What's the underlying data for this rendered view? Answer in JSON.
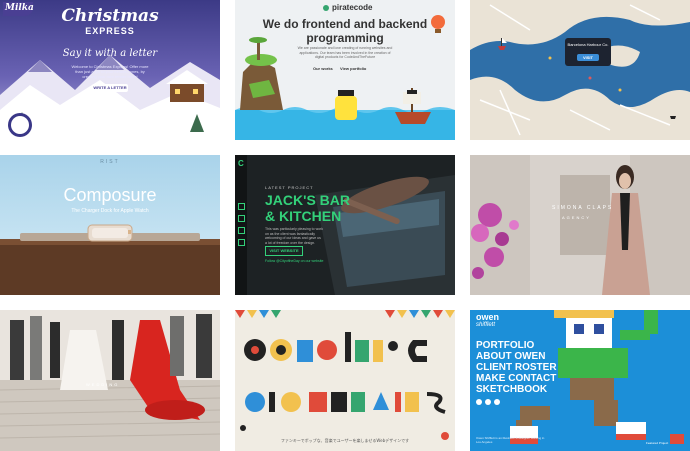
{
  "tiles": {
    "milka": {
      "logo": "Milka",
      "title_line1": "Christmas",
      "title_line2": "EXPRESS",
      "tagline": "Say it with a letter",
      "body": "Welcome to Christmas Express! Offer more than just a gift to your beloved ones, by creating your own tender letter!",
      "button": "WRITE A LETTER"
    },
    "piratecode": {
      "logo": "piratecode",
      "headline_line1": "We do frontend and backend",
      "headline_line2": "programming",
      "body": "We are passionate and love creating of running websites and applications. Our team has been involved in the creation of digital products for CodeAndTheFuture",
      "link1": "Our works",
      "link2": "View portfolio"
    },
    "map": {
      "popup_title": "Barcelona Harbour Co.",
      "popup_button": "VISIT"
    },
    "composure": {
      "brand": "RIST",
      "title": "Composure",
      "subtitle": "The Charger Dock for Apple Watch"
    },
    "jacks": {
      "logo": "C",
      "label": "LATEST PROJECT",
      "title_line1": "JACK'S BAR",
      "title_line2": "& KITCHEN",
      "body": "This was particularly pleasing to work on as the client was fantastically welcoming of our ideas and gave us a lot of freedom over the design.",
      "button": "VISIT WEBSITE",
      "footer": "Follow @CityoftheDay on our website"
    },
    "fashion": {
      "name": "SIMONA CLAPS",
      "subtitle": "AGENCY"
    },
    "wedding": {
      "caption": "WEDDING"
    },
    "music": {
      "footer": "ファンキーでポップな、音楽でユーザーを楽しませるWebデザインです"
    },
    "owen": {
      "logo_line1": "owen",
      "logo_line2": "shifflett",
      "menu": [
        "PORTFOLIO",
        "ABOUT OWEN",
        "CLIENT ROSTER",
        "MAKE CONTACT",
        "SKETCHBOOK"
      ],
      "footer": "Owen Shifflett is an illustrator & designer working in Los Angeles",
      "corner": "Featured Project"
    }
  },
  "colors": {
    "milka_purple": "#4a3f93",
    "pirate_green": "#35a56f",
    "jacks_green": "#33d17a",
    "owen_blue": "#1c8fd8"
  }
}
